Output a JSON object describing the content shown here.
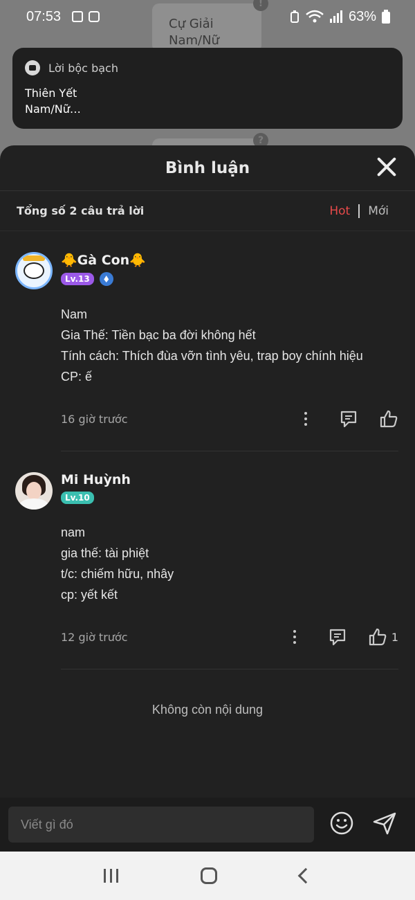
{
  "background": {
    "card_text_1": "Cự Giải",
    "card_text_2": "Nam/Nữ",
    "badge_1": "!",
    "badge_2": "?"
  },
  "status_bar": {
    "time": "07:53",
    "battery": "63%"
  },
  "notification": {
    "app_name": "Lời bộc bạch",
    "body": "Thiên Yết\nNam/Nữ…"
  },
  "sheet": {
    "title": "Bình luận",
    "count_text": "Tổng số 2 câu trả lời",
    "sort_hot": "Hot",
    "sort_new": "Mới",
    "comments": [
      {
        "name": "🐥Gà Con🐥",
        "level": "Lv.13",
        "lines": [
          "Nam",
          "Gia Thế: Tiền bạc ba đời không hết",
          "Tính cách: Thích đùa vỡn tình yêu, trap boy chính hiệu",
          "CP: ế"
        ],
        "time": "16 giờ trước",
        "likes": ""
      },
      {
        "name": "Mi Huỳnh",
        "level": "Lv.10",
        "lines": [
          "nam",
          "gia thế: tài phiệt",
          "t/c: chiếm hữu, nhây",
          "cp: yết kết"
        ],
        "time": "12 giờ trước",
        "likes": "1"
      }
    ],
    "no_more": "Không còn nội dung"
  },
  "input": {
    "placeholder": "Viết gì đó"
  },
  "colors": {
    "sheet_bg": "#212121",
    "accent_hot": "#e84a4a",
    "level_purple": "#9b59e8",
    "level_teal": "#3bbfb0"
  }
}
